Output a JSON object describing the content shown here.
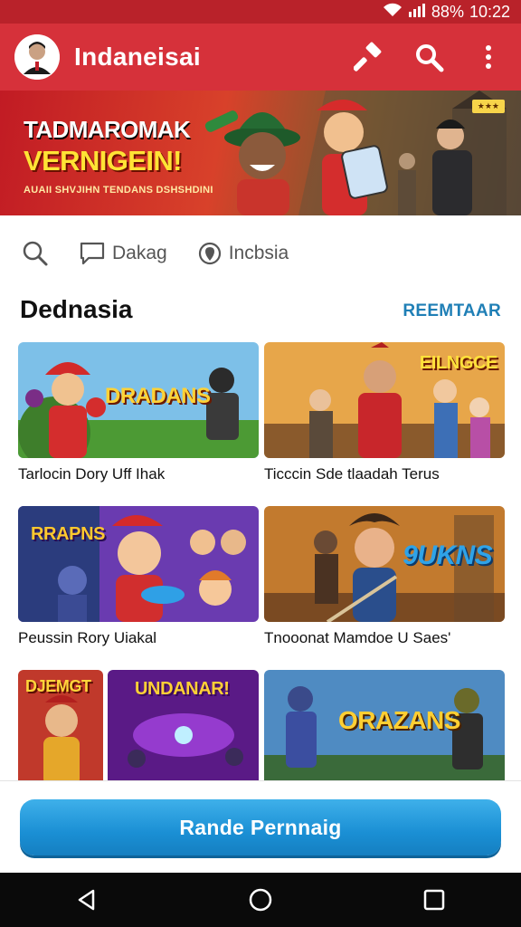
{
  "status_bar": {
    "battery": "88%",
    "time": "10:22"
  },
  "app_bar": {
    "title": "Indaneisai"
  },
  "hero": {
    "line1": "TADMAROMAK",
    "line2": "VERNIGEIN!",
    "line3": "AUAII SHVJIHN TENDANS DSHSHDINI"
  },
  "subnav": {
    "items": [
      {
        "icon": "search-icon",
        "label": ""
      },
      {
        "icon": "chat-icon",
        "label": "Dakag"
      },
      {
        "icon": "location-icon",
        "label": "Incbsia"
      }
    ]
  },
  "section": {
    "title": "Dednasia",
    "link": "REEMTAAR"
  },
  "games": [
    {
      "title": "Tarlocin Dory Uff Ihak",
      "banner": "DRADANS"
    },
    {
      "title": "Ticccin Sde tlaadah Terus",
      "banner": "EILNGCE"
    },
    {
      "title": "Peussin Rory Uiakal",
      "banner": "RRAPNS"
    },
    {
      "title": "Tnooonat Mamdoe U Saes'",
      "banner": "9UKNS"
    },
    {
      "title": "",
      "banner": "DJEMGT"
    },
    {
      "title": "",
      "banner": "UNDANAR!"
    },
    {
      "title": "",
      "banner": "ORAZANS"
    }
  ],
  "cta": {
    "label": "Rande Pernnaig"
  },
  "colors": {
    "app_bar": "#d6313a",
    "accent_link": "#1f7fb6",
    "cta": "#1a8fd4"
  }
}
